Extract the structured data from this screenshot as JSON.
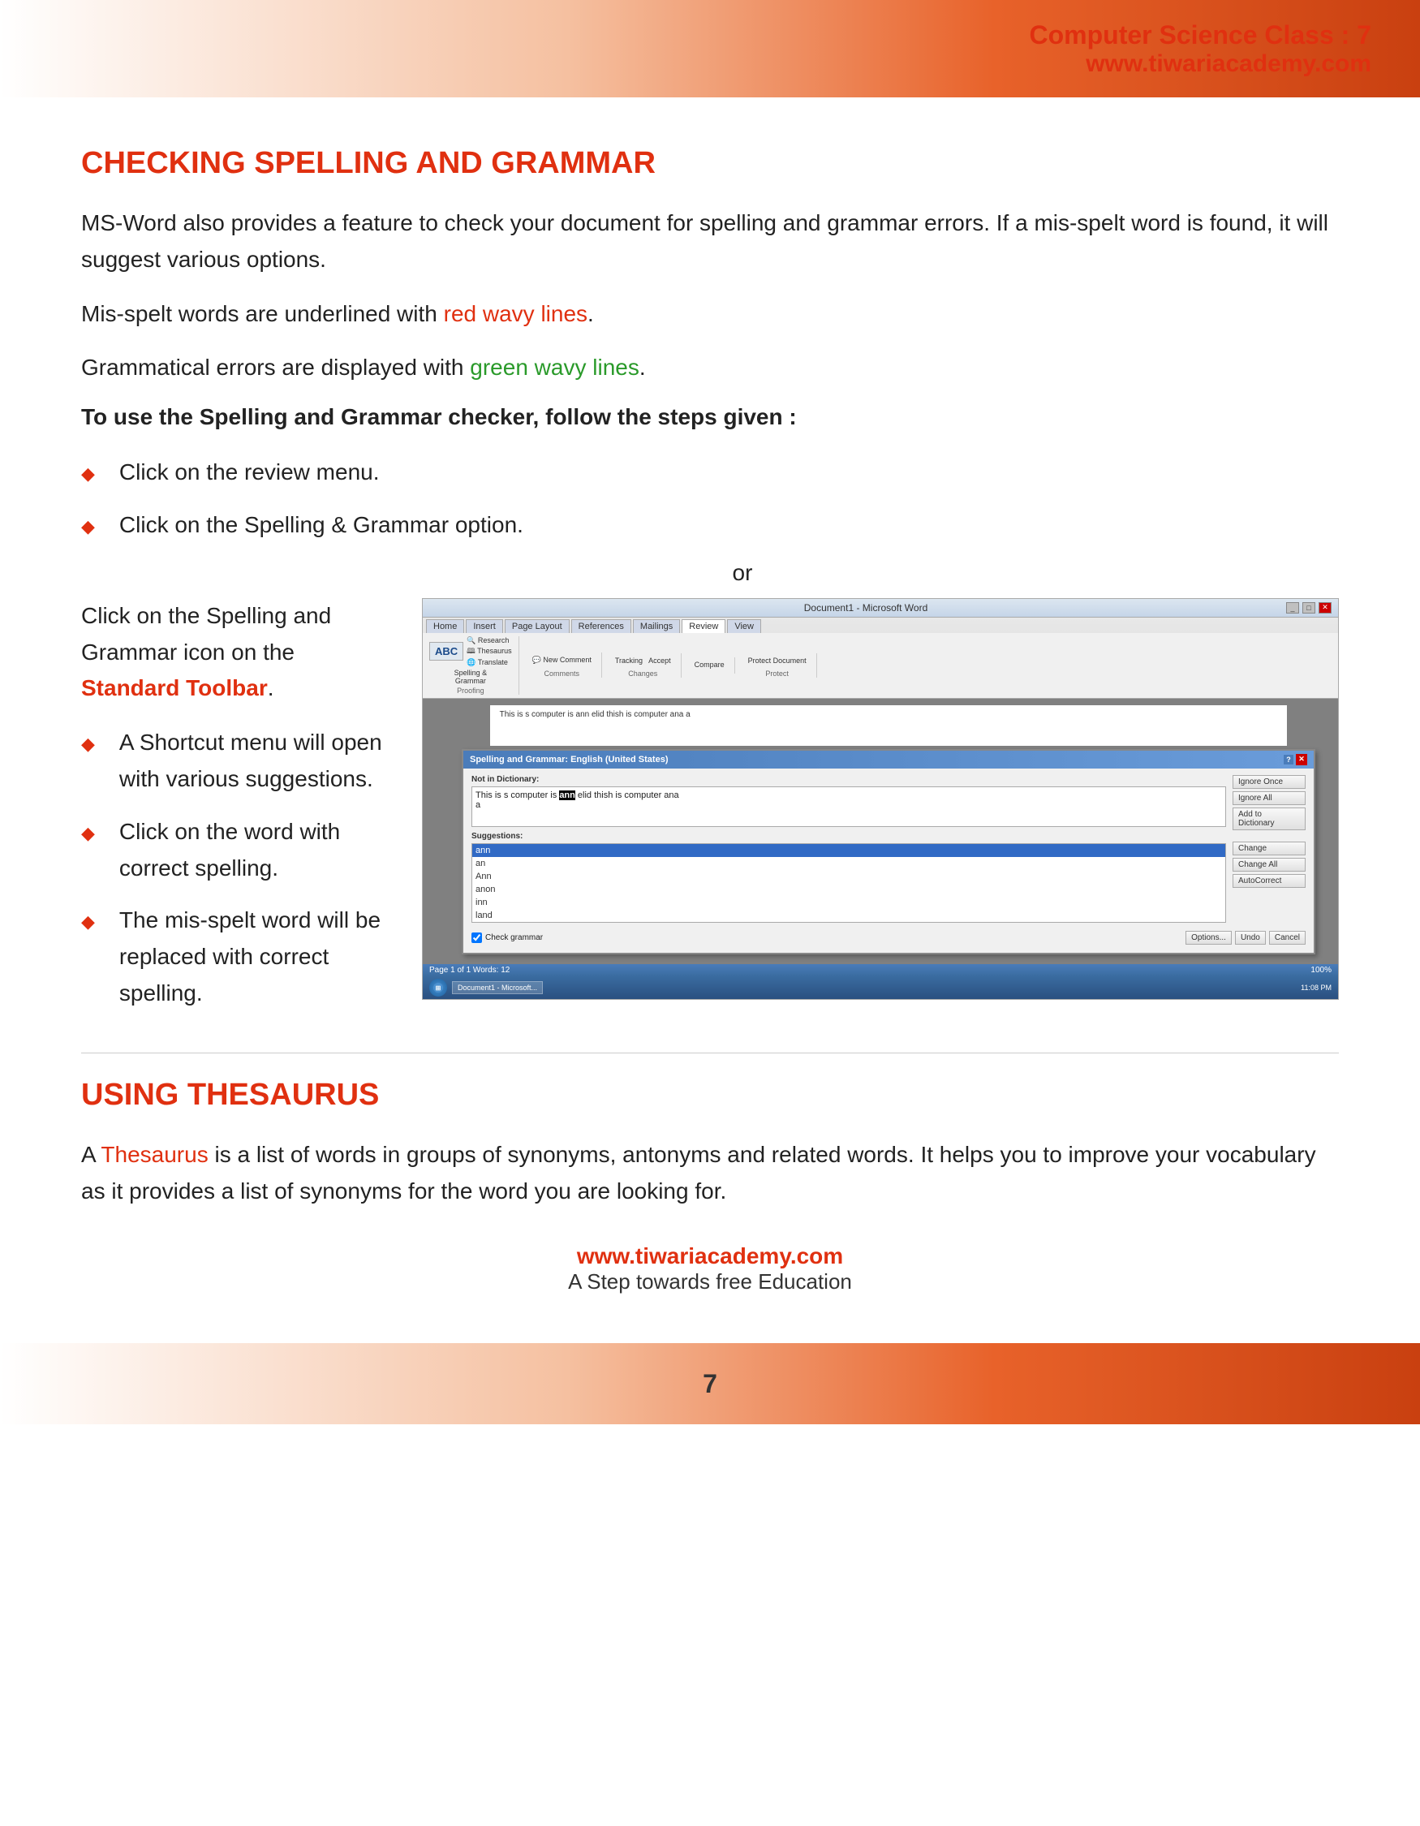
{
  "header": {
    "title": "Computer Science Class : 7",
    "url": "www.tiwariacademy.com"
  },
  "section1": {
    "heading": "CHECKING SPELLING AND GRAMMAR",
    "para1": "MS-Word also provides a feature to check your document for spelling and grammar errors. If a mis-spelt word is found, it will suggest various options.",
    "para2_prefix": "Mis-spelt words are underlined with ",
    "para2_highlight": "red wavy lines",
    "para2_suffix": ".",
    "para3_prefix": "Grammatical errors are displayed with ",
    "para3_highlight": "green wavy lines",
    "para3_suffix": ".",
    "steps_heading": "To use the Spelling and Grammar checker, follow the steps given :",
    "steps": [
      {
        "text": "Click on the review menu."
      },
      {
        "text": "Click on the Spelling & Grammar option."
      }
    ],
    "or_text": "or",
    "left_col_text": "Click on the Spelling and Grammar icon on the ",
    "left_col_highlight": "Standard Toolbar",
    "left_col_suffix": ".",
    "more_steps": [
      {
        "text": "A Shortcut menu will open with various suggestions."
      },
      {
        "text": "Click on the word with correct spelling."
      },
      {
        "text": "The mis-spelt word will be replaced with correct spelling."
      }
    ]
  },
  "word_screenshot": {
    "title": "Document1 - Microsoft Word",
    "tabs": [
      "Home",
      "Insert",
      "Page Layout",
      "References",
      "Mailings",
      "Review",
      "View"
    ],
    "active_tab": "Review",
    "groups": [
      "Proofing",
      "Comments",
      "Changes",
      "Protect"
    ],
    "group_btns": [
      "ABC",
      "Spelling &",
      "Grammar"
    ],
    "dialog_title": "Spelling and Grammar: English (United States)",
    "not_in_dict_label": "Not in Dictionary:",
    "text_content": "This is s computer is ann elid thish is computer ana a",
    "suggestions_label": "Suggestions:",
    "suggestions": [
      "ann",
      "an",
      "Ann",
      "anon",
      "inn",
      "land"
    ],
    "selected_suggestion": "ann",
    "buttons": [
      "Ignore Once",
      "Ignore All",
      "Add to Dictionary",
      "Change",
      "Change All",
      "AutoCorrect",
      "Cancel"
    ],
    "check_grammar_label": "Check grammar",
    "options_btn": "Options...",
    "undo_btn": "Undo",
    "status_bar": "Page 1 of 1   Words: 12",
    "time": "11:08 PM"
  },
  "section2": {
    "heading": "USING THESAURUS",
    "para1_prefix": "A ",
    "para1_highlight": "Thesaurus",
    "para1_text": " is a list of words in groups of synonyms, antonyms and related words. It helps you to improve your vocabulary as it provides a list of synonyms for the word you are looking for."
  },
  "footer": {
    "url": "www.tiwariacademy.com",
    "tagline": "A Step towards free Education",
    "page_number": "7"
  }
}
